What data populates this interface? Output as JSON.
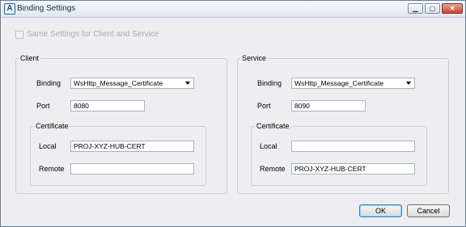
{
  "window": {
    "title": "Binding Settings",
    "icon": "app-logo-icon",
    "controls": {
      "minimize": "minimize-icon",
      "maximize": "maximize-icon",
      "close": "close-icon"
    }
  },
  "same_settings": {
    "label": "Same Settings for Client and Service",
    "checked": false,
    "enabled": false
  },
  "client": {
    "title": "Client",
    "binding_label": "Binding",
    "binding_value": "WsHttp_Message_Certificate",
    "port_label": "Port",
    "port_value": "8080",
    "certificate": {
      "title": "Certificate",
      "local_label": "Local",
      "local_value": "PROJ-XYZ-HUB-CERT",
      "remote_label": "Remote",
      "remote_value": ""
    }
  },
  "service": {
    "title": "Service",
    "binding_label": "Binding",
    "binding_value": "WsHttp_Message_Certificate",
    "port_label": "Port",
    "port_value": "8090",
    "certificate": {
      "title": "Certificate",
      "local_label": "Local",
      "local_value": "",
      "remote_label": "Remote",
      "remote_value": "PROJ-XYZ-HUB-CERT"
    }
  },
  "buttons": {
    "ok": "OK",
    "cancel": "Cancel"
  }
}
